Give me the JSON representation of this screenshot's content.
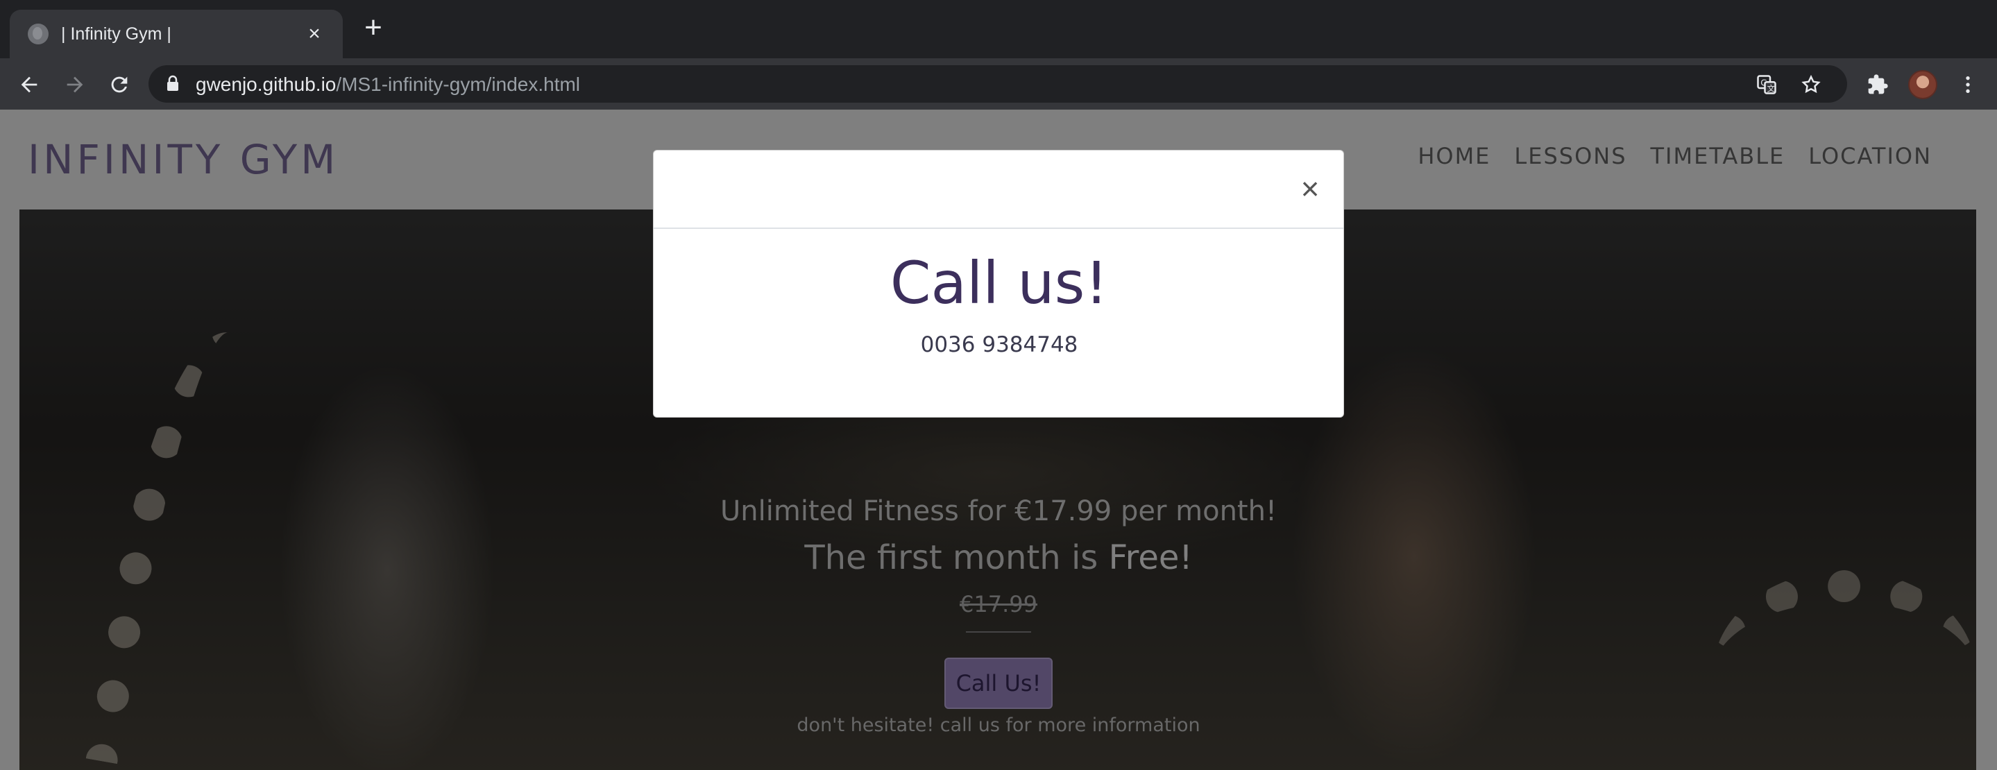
{
  "browser": {
    "tab_title": "| Infinity Gym |",
    "url_domain": "gwenjo.github.io",
    "url_path": "/MS1-infinity-gym/index.html"
  },
  "site": {
    "logo": "INFINITY GYM",
    "nav": [
      "HOME",
      "LESSONS",
      "TIMETABLE",
      "LOCATION"
    ]
  },
  "hero": {
    "offer_line1": "Unlimited Fitness for €17.99 per month!",
    "offer_line2_prefix": "The first month is ",
    "offer_line2_bold": "Free!",
    "old_price": "€17.99",
    "cta_label": "Call Us!",
    "hint": "don't hesitate! call us for more information"
  },
  "modal": {
    "close_symbol": "×",
    "title": "Call us!",
    "phone": "0036 9384748"
  },
  "colors": {
    "brand_purple": "#7e6fa1",
    "cta_purple": "#a48fce",
    "modal_title": "#3c2f5c"
  }
}
